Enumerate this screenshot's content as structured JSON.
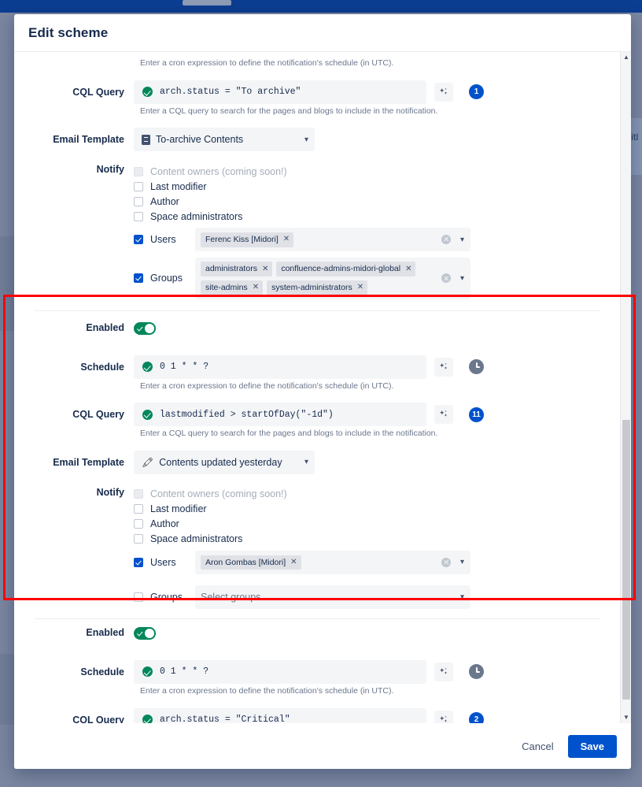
{
  "background": {
    "card_text": "citl"
  },
  "dialog": {
    "title": "Edit scheme",
    "footer": {
      "cancel_label": "Cancel",
      "save_label": "Save"
    }
  },
  "helpers": {
    "schedule": "Enter a cron expression to define the notification's schedule (in UTC).",
    "cql": "Enter a CQL query to search for the pages and blogs to include in the notification."
  },
  "labels": {
    "enabled": "Enabled",
    "schedule": "Schedule",
    "cql_query": "CQL Query",
    "email_template": "Email Template",
    "notify": "Notify"
  },
  "notify_options": {
    "content_owners": "Content owners (coming soon!)",
    "last_modifier": "Last modifier",
    "author": "Author",
    "space_admins": "Space administrators",
    "users": "Users",
    "groups": "Groups"
  },
  "colors": {
    "accent": "#0052cc",
    "success": "#00875a",
    "highlight": "#ff0000",
    "topbar": "#0b3d91"
  },
  "notifications": [
    {
      "partial_top": true,
      "cql_query": "arch.status = \"To archive\"",
      "cql_badge": "1",
      "email_template": "To-archive Contents",
      "email_template_icon": "document-icon",
      "notify": {
        "content_owners_checked": false,
        "last_modifier_checked": false,
        "author_checked": false,
        "space_admins_checked": false,
        "users_checked": true,
        "users_tags": [
          "Ferenc Kiss [Midori]"
        ],
        "groups_checked": true,
        "groups_tags": [
          "administrators",
          "confluence-admins-midori-global",
          "site-admins",
          "system-administrators"
        ],
        "groups_placeholder": ""
      }
    },
    {
      "highlighted": true,
      "enabled": true,
      "schedule": "0 1 * * ?",
      "cql_query": "lastmodified > startOfDay(\"-1d\")",
      "cql_badge": "11",
      "email_template": "Contents updated yesterday",
      "email_template_icon": "pencil-icon",
      "notify": {
        "content_owners_checked": false,
        "last_modifier_checked": false,
        "author_checked": false,
        "space_admins_checked": false,
        "users_checked": true,
        "users_tags": [
          "Aron Gombas [Midori]"
        ],
        "groups_checked": false,
        "groups_tags": [],
        "groups_placeholder": "Select groups"
      }
    },
    {
      "partial_bottom": true,
      "enabled": true,
      "schedule": "0 1 * * ?",
      "cql_query": "arch.status = \"Critical\"",
      "cql_badge": "2"
    }
  ]
}
